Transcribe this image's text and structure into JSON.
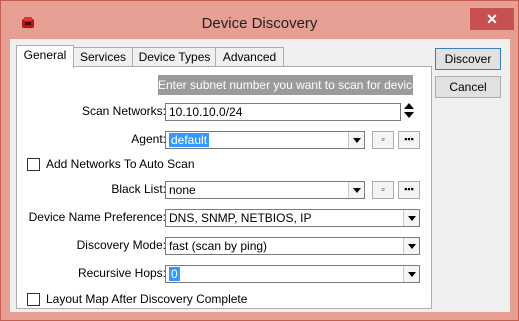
{
  "window": {
    "title": "Device Discovery",
    "close_label": "✕"
  },
  "tabs": [
    {
      "label": "General",
      "active": true
    },
    {
      "label": "Services",
      "active": false
    },
    {
      "label": "Device Types",
      "active": false
    },
    {
      "label": "Advanced",
      "active": false
    }
  ],
  "general": {
    "info_colon": ":",
    "info_text": "Enter subnet number you want to scan for devices",
    "scan_networks_label": "Scan Networks:",
    "scan_networks_value": "10.10.10.0/24",
    "agent_label": "Agent:",
    "agent_value": "default",
    "small_btn_label": "▫",
    "ellipsis_btn_label": "▪▪▪",
    "add_networks_label": "Add Networks To Auto Scan",
    "black_list_label": "Black List:",
    "black_list_value": "none",
    "device_name_pref_label": "Device Name Preference:",
    "device_name_pref_value": "DNS, SNMP, NETBIOS, IP",
    "discovery_mode_label": "Discovery Mode:",
    "discovery_mode_value": "fast (scan by ping)",
    "recursive_hops_label": "Recursive Hops:",
    "recursive_hops_value": "0",
    "layout_map_label": "Layout Map After Discovery Complete"
  },
  "buttons": {
    "discover": "Discover",
    "cancel": "Cancel"
  },
  "colors": {
    "titlebar": "#e89f93",
    "close": "#c75050",
    "selection": "#3399ff"
  }
}
